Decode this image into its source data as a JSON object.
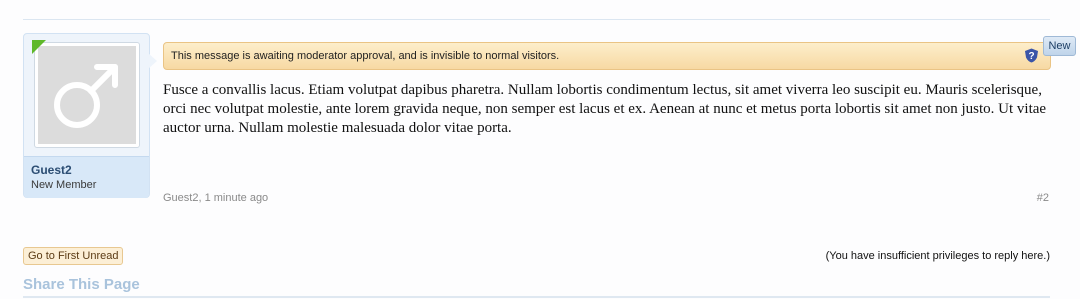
{
  "post": {
    "user": {
      "name": "Guest2",
      "title": "New Member"
    },
    "moderation_notice": "This message is awaiting moderator approval, and is invisible to normal visitors.",
    "new_badge": "New",
    "message": "Fusce a convallis lacus. Etiam volutpat dapibus pharetra. Nullam lobortis condimentum lectus, sit amet viverra leo suscipit eu. Mauris scelerisque, orci nec volutpat molestie, ante lorem gravida neque, non semper est lacus et ex. Aenean at nunc et metus porta lobortis sit amet non justo. Ut vitae auctor urna. Nullam molestie malesuada dolor vitae porta.",
    "meta": "Guest2, 1 minute ago",
    "permalink": "#2",
    "icons": {
      "avatar": "male-symbol-icon",
      "help": "question-shield-icon"
    }
  },
  "footer": {
    "first_unread_button": "Go to First Unread",
    "reply_notice": "(You have insufficient privileges to reply here.)",
    "share_title": "Share This Page"
  },
  "colors": {
    "online_indicator": "#5fb82a",
    "moderation_bg": "#f7d9a3",
    "link": "#2b4d73"
  }
}
